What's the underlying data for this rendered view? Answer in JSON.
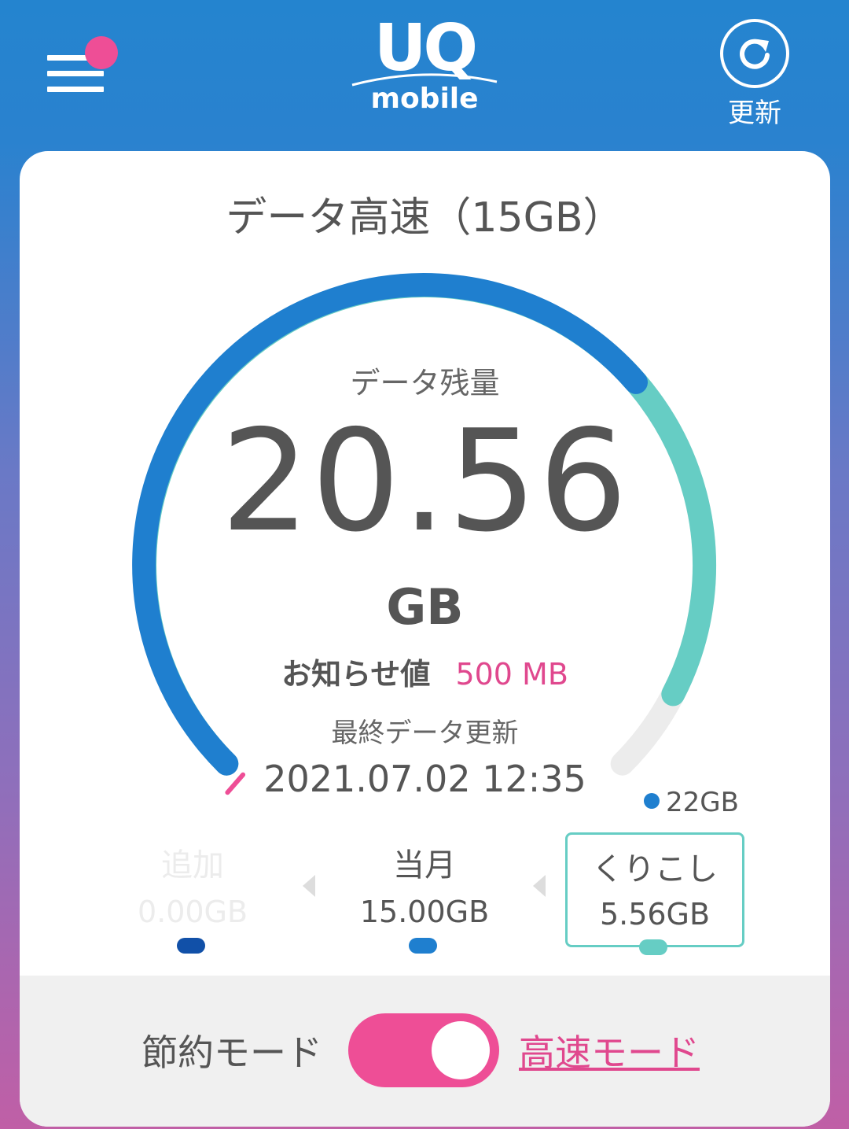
{
  "header": {
    "logo_top": "UQ",
    "logo_bottom": "mobile",
    "refresh_label": "更新",
    "menu_badge_color": "#ee4e96"
  },
  "card": {
    "title": "データ高速（15GB）",
    "remaining_label": "データ残量",
    "remaining_value": "20.56",
    "remaining_unit": "GB",
    "notice_label": "お知らせ値",
    "notice_value": "500 MB",
    "updated_label": "最終データ更新",
    "updated_value": "2021.07.02 12:35",
    "cap_label": "22GB"
  },
  "gauge": {
    "total_gb": 22,
    "monthly_gb": 15.0,
    "carryover_gb": 5.56,
    "added_gb": 0.0,
    "notice_gb": 0.5,
    "colors": {
      "monthly": "#1f7fcf",
      "carryover": "#66cdc4",
      "empty": "#ececec",
      "notice": "#ee4e96",
      "added": "#1150a8"
    }
  },
  "segments": {
    "added": {
      "name": "追加",
      "value": "0.00GB"
    },
    "current": {
      "name": "当月",
      "value": "15.00GB"
    },
    "carryover": {
      "name": "くりこし",
      "value": "5.56GB"
    }
  },
  "footer": {
    "eco_mode_label": "節約モード",
    "fast_mode_label": "高速モード",
    "toggle_on": true
  }
}
